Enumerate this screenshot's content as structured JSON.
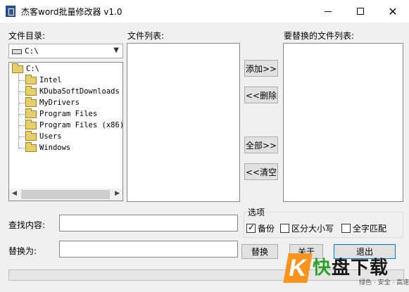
{
  "window": {
    "title": "杰客word批量修改器 v1.0",
    "minimize": "",
    "maximize": "",
    "close": "✕"
  },
  "left": {
    "dir_label": "文件目录:",
    "drive_value": "C:\\",
    "tree": {
      "root": "C:\\",
      "children": [
        "Intel",
        "KDubaSoftDownloads",
        "MyDrivers",
        "Program Files",
        "Program Files (x86)",
        "Users",
        "Windows"
      ]
    }
  },
  "middle": {
    "file_list_label": "文件列表:"
  },
  "right": {
    "replace_list_label": "要替换的文件列表:"
  },
  "buttons": {
    "add": "添加>>",
    "remove": "<<删除",
    "all": "全部>>",
    "clear": "<<清空",
    "replace": "替换",
    "close": "关于",
    "exit": "退出"
  },
  "form": {
    "find_label": "查找内容:",
    "find_value": "",
    "replace_label": "替换为:",
    "replace_value": ""
  },
  "options": {
    "title": "选项",
    "backup": {
      "label": "备份",
      "checked": true
    },
    "match_case": {
      "label": "区分大小写",
      "checked": false
    },
    "whole_word": {
      "label": "全字匹配",
      "checked": false
    }
  },
  "watermark": {
    "logo_letter": "K",
    "brand_first": "快",
    "brand_rest": "盘下载",
    "tagline": "绿色 · 安全 · 高速"
  }
}
